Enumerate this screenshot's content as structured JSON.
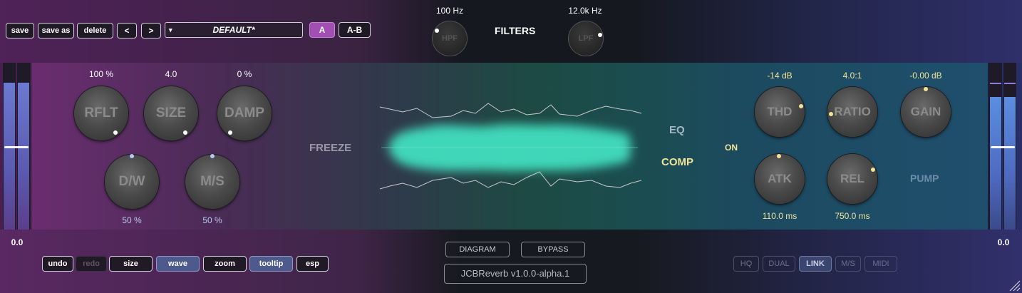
{
  "toolbar": {
    "save": "save",
    "save_as": "save as",
    "delete": "delete",
    "prev": "<",
    "next": ">",
    "preset_caret": "▾",
    "preset_name": "DEFAULT*",
    "a": "A",
    "ab": "A-B"
  },
  "filters": {
    "title": "FILTERS",
    "hpf": {
      "label": "HPF",
      "value": "100 Hz"
    },
    "lpf": {
      "label": "LPF",
      "value": "12.0k Hz"
    }
  },
  "reverb": {
    "reflt": {
      "label": "RFLT",
      "value": "100 %"
    },
    "size": {
      "label": "SIZE",
      "value": "4.0"
    },
    "damp": {
      "label": "DAMP",
      "value": "0 %"
    },
    "dw": {
      "label": "D/W",
      "value": "50 %"
    },
    "ms": {
      "label": "M/S",
      "value": "50 %"
    },
    "freeze": "FREEZE"
  },
  "sections": {
    "eq": "EQ",
    "comp": "COMP",
    "on": "ON",
    "pump": "PUMP"
  },
  "comp": {
    "thd": {
      "label": "THD",
      "value": "-14 dB"
    },
    "ratio": {
      "label": "RATIO",
      "value": "4.0:1"
    },
    "gain": {
      "label": "GAIN",
      "value": "-0.00 dB"
    },
    "atk": {
      "label": "ATK",
      "value": "110.0 ms"
    },
    "rel": {
      "label": "REL",
      "value": "750.0 ms"
    }
  },
  "meters": {
    "left_value": "0.0",
    "right_value": "0.0"
  },
  "bottom": {
    "undo": "undo",
    "redo": "redo",
    "size": "size",
    "wave": "wave",
    "zoom": "zoom",
    "tooltip": "tooltip",
    "esp": "esp",
    "diagram": "DIAGRAM",
    "bypass": "BYPASS",
    "version": "JCBReverb v1.0.0-alpha.1",
    "hq": "HQ",
    "dual": "DUAL",
    "link": "LINK",
    "ms": "M/S",
    "midi": "MIDI"
  },
  "colors": {
    "accent_purple": "#a24fb4",
    "wave_teal": "#3fd6b8",
    "comp_gold": "#f0e39a"
  }
}
